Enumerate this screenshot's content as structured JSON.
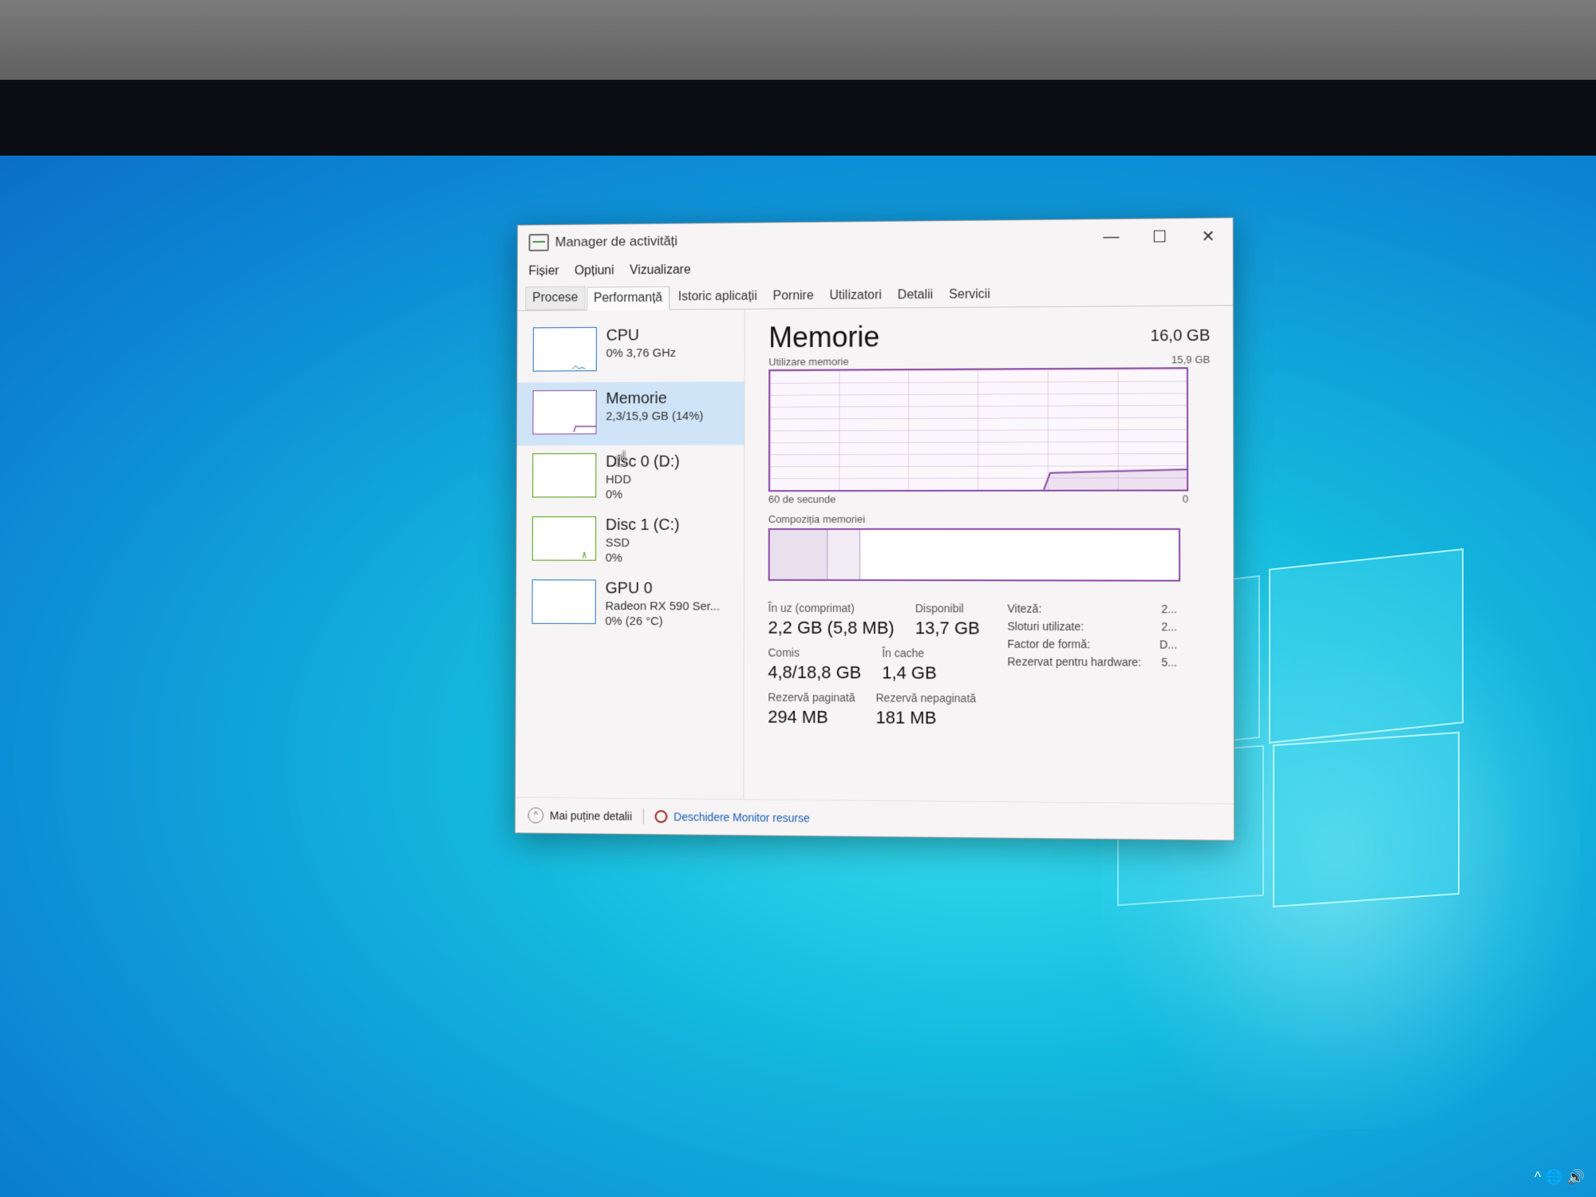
{
  "window": {
    "title": "Manager de activități",
    "controls": {
      "minimize": "—",
      "maximize": "☐",
      "close": "✕"
    }
  },
  "menu": [
    "Fișier",
    "Opțiuni",
    "Vizualizare"
  ],
  "tabs": [
    "Procese",
    "Performanță",
    "Istoric aplicații",
    "Pornire",
    "Utilizatori",
    "Detalii",
    "Servicii"
  ],
  "active_tab": "Performanță",
  "sidebar": [
    {
      "title": "CPU",
      "line1": "0% 3,76 GHz",
      "line2": "",
      "color": "#1f6fbf"
    },
    {
      "title": "Memorie",
      "line1": "2,3/15,9 GB (14%)",
      "line2": "",
      "color": "#8b4aa5"
    },
    {
      "title": "Disc 0 (D:)",
      "line1": "HDD",
      "line2": "0%",
      "color": "#4e9a06"
    },
    {
      "title": "Disc 1 (C:)",
      "line1": "SSD",
      "line2": "0%",
      "color": "#4e9a06"
    },
    {
      "title": "GPU 0",
      "line1": "Radeon RX 590 Ser...",
      "line2": "0% (26 °C)",
      "color": "#1f6fbf"
    }
  ],
  "main": {
    "title": "Memorie",
    "total": "16,0 GB",
    "usage_label": "Utilizare memorie",
    "usage_max": "15,9 GB",
    "time_label": "60 de secunde",
    "time_end": "0",
    "composition_label": "Compoziția memoriei",
    "usage_level": 0.14,
    "stats": {
      "in_use_label": "În uz (comprimat)",
      "in_use_value": "2,2 GB (5,8 MB)",
      "available_label": "Disponibil",
      "available_value": "13,7 GB",
      "committed_label": "Comis",
      "committed_value": "4,8/18,8 GB",
      "cached_label": "În cache",
      "cached_value": "1,4 GB",
      "paged_label": "Rezervă paginată",
      "paged_value": "294 MB",
      "nonpaged_label": "Rezervă nepaginată",
      "nonpaged_value": "181 MB"
    },
    "details": [
      {
        "key": "Viteză:",
        "value": "2..."
      },
      {
        "key": "Sloturi utilizate:",
        "value": "2..."
      },
      {
        "key": "Factor de formă:",
        "value": "D..."
      },
      {
        "key": "Rezervat pentru hardware:",
        "value": "5..."
      }
    ]
  },
  "footer": {
    "fewer_details": "Mai puține detalii",
    "open_monitor": "Deschidere Monitor resurse"
  },
  "tray": "^ 🌐 🔊"
}
